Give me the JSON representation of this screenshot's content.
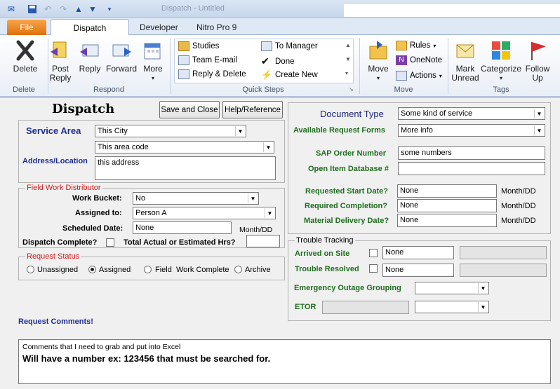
{
  "titlebar": {
    "title": "Dispatch - Untitled"
  },
  "tabs": {
    "file": "File",
    "items": [
      {
        "label": "Dispatch"
      },
      {
        "label": "Developer"
      },
      {
        "label": "Nitro Pro 9"
      }
    ]
  },
  "ribbon": {
    "delete_group": {
      "label": "Delete",
      "delete_btn": "Delete"
    },
    "respond_group": {
      "label": "Respond",
      "post_reply": "Post Reply",
      "reply": "Reply",
      "forward": "Forward",
      "more": "More"
    },
    "quick_steps": {
      "label": "Quick Steps",
      "items": [
        "Studies",
        "To Manager",
        "Team E-mail",
        "Done",
        "Reply & Delete",
        "Create New"
      ]
    },
    "move_group": {
      "label": "Move",
      "move": "Move",
      "rules": "Rules",
      "onenote": "OneNote",
      "actions": "Actions"
    },
    "tags_group": {
      "label": "Tags",
      "mark_unread": "Mark Unread",
      "categorize": "Categorize",
      "follow_up": "Follow Up"
    }
  },
  "form": {
    "title": "Dispatch",
    "save_close": "Save and Close",
    "help": "Help/Reference",
    "service_area_label": "Service Area",
    "service_area_value": "This City",
    "area_code_value": "This area code",
    "address_label": "Address/Location",
    "address_value": "this address",
    "fwd": {
      "legend": "Field Work Distributor",
      "work_bucket_label": "Work Bucket:",
      "work_bucket_value": "No",
      "assigned_to_label": "Assigned to:",
      "assigned_to_value": "Person A",
      "scheduled_date_label": "Scheduled Date:",
      "scheduled_date_value": "None",
      "month_dd": "Month/DD",
      "dispatch_complete_label": "Dispatch Complete?",
      "total_hrs_label": "Total Actual or Estimated Hrs?"
    },
    "status": {
      "legend": "Request Status",
      "options": [
        "Unassigned",
        "Assigned",
        "Field  Work Complete",
        "Archive"
      ],
      "selected": 1
    },
    "comments_label": "Request Comments!",
    "comments_line1": "Comments that I need to grab and put into Excel",
    "comments_line2": "Will have a number ex: 123456 that must be searched for.",
    "doc_type_label": "Document Type",
    "doc_type_value": "Some kind of service",
    "avail_forms_label": "Available Request Forms",
    "avail_forms_value": "More info",
    "sap_label": "SAP Order Number",
    "sap_value": "some numbers",
    "open_item_label": "Open Item Database #",
    "open_item_value": "",
    "req_start_label": "Requested Start Date?",
    "req_start_value": "None",
    "req_completion_label": "Required Completion?",
    "req_completion_value": "None",
    "mat_delivery_label": "Material Delivery Date?",
    "mat_delivery_value": "None",
    "month_dd": "Month/DD",
    "trouble": {
      "legend": "Trouble Tracking",
      "arrived_label": "Arrived on Site",
      "arrived_value": "None",
      "resolved_label": "Trouble Resolved",
      "resolved_value": "None",
      "emergency_label": "Emergency Outage Grouping",
      "etor_label": "ETOR"
    }
  }
}
